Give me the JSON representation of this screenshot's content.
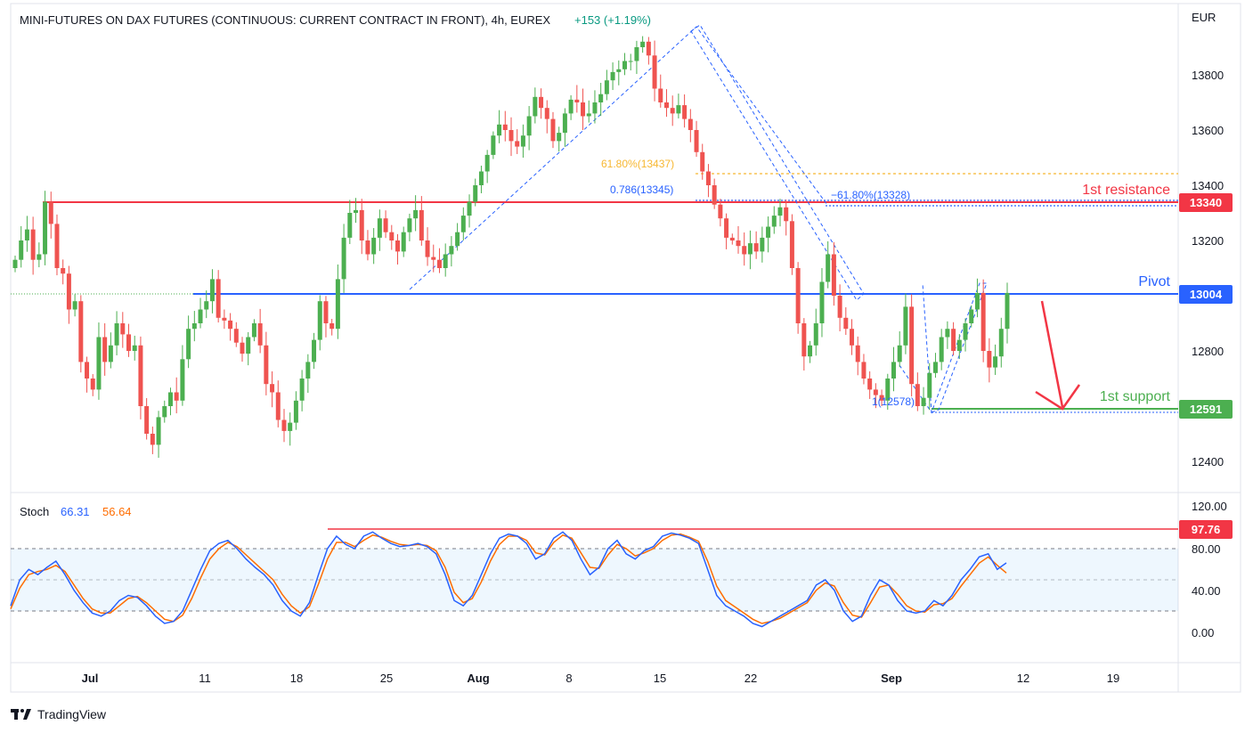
{
  "header": {
    "title": "MINI-FUTURES ON DAX FUTURES (CONTINUOUS: CURRENT CONTRACT IN FRONT), 4h, EUREX",
    "change": "+153 (+1.19%)",
    "currency": "EUR"
  },
  "annotations": {
    "fib_618_label": "61.80%(13437)",
    "fib_786_label": "0.786(13345)",
    "fib_neg618_label": "−61.80%(13328)",
    "fib_one_label": "1(12578)",
    "resistance_label": "1st resistance",
    "pivot_label": "Pivot",
    "support_label": "1st support"
  },
  "price_axis": {
    "ticks": [
      "13800",
      "13600",
      "13400",
      "13200",
      "12800",
      "12400"
    ],
    "badges": {
      "resistance": "13340",
      "pivot": "13004",
      "support": "12591"
    }
  },
  "stoch": {
    "label": "Stoch",
    "k_value": "66.31",
    "d_value": "56.64",
    "ticks": [
      "120.00",
      "80.00",
      "40.00",
      "0.00"
    ],
    "badge": "97.76"
  },
  "time_axis": {
    "labels": [
      "Jul",
      "11",
      "18",
      "25",
      "Aug",
      "8",
      "15",
      "22",
      "Sep",
      "12",
      "19"
    ]
  },
  "footer": {
    "brand": "TradingView"
  },
  "colors": {
    "up": "#26a69a",
    "up_body": "#4caf50",
    "down": "#ef5350",
    "resistance": "#f23645",
    "pivot": "#2962ff",
    "support": "#4caf50",
    "fib618": "#f7b731",
    "stoch_k": "#2962ff",
    "stoch_d": "#ff6d00"
  },
  "chart_data": [
    {
      "type": "candlestick",
      "title": "MINI-FUTURES ON DAX FUTURES (CONTINUOUS: CURRENT CONTRACT IN FRONT), 4h, EUREX",
      "ylabel": "EUR",
      "ylim": [
        12300,
        13900
      ],
      "x_ticks": [
        "Jul",
        "11",
        "18",
        "25",
        "Aug",
        "8",
        "15",
        "22",
        "Sep",
        "12",
        "19"
      ],
      "closes": [
        13130,
        13200,
        13240,
        13130,
        13150,
        13340,
        13260,
        13100,
        13080,
        12950,
        12980,
        12760,
        12700,
        12660,
        12850,
        12760,
        12820,
        12900,
        12860,
        12800,
        12820,
        12600,
        12500,
        12460,
        12560,
        12600,
        12650,
        12620,
        12770,
        12880,
        12900,
        12950,
        12980,
        13060,
        12920,
        12910,
        12880,
        12830,
        12790,
        12850,
        12900,
        12820,
        12680,
        12650,
        12550,
        12510,
        12540,
        12620,
        12700,
        12760,
        12840,
        12980,
        12900,
        12880,
        13060,
        13210,
        13300,
        13310,
        13200,
        13150,
        13210,
        13280,
        13230,
        13200,
        13160,
        13230,
        13280,
        13310,
        13200,
        13140,
        13130,
        13100,
        13150,
        13180,
        13230,
        13290,
        13340,
        13400,
        13450,
        13510,
        13580,
        13620,
        13600,
        13560,
        13540,
        13580,
        13650,
        13720,
        13680,
        13640,
        13560,
        13590,
        13660,
        13710,
        13700,
        13650,
        13660,
        13700,
        13730,
        13780,
        13810,
        13820,
        13850,
        13850,
        13900,
        13920,
        13870,
        13750,
        13700,
        13680,
        13660,
        13690,
        13640,
        13600,
        13520,
        13450,
        13400,
        13330,
        13280,
        13210,
        13200,
        13180,
        13150,
        13190,
        13160,
        13210,
        13250,
        13290,
        13320,
        13270,
        13100,
        12900,
        12780,
        12820,
        12900,
        13050,
        13150,
        13000,
        12920,
        12880,
        12820,
        12760,
        12700,
        12660,
        12640,
        12620,
        12700,
        12760,
        12820,
        12960,
        12680,
        12600,
        12630,
        12720,
        12760,
        12850,
        12880,
        12800,
        12840,
        12900,
        12950,
        13010,
        12800,
        12740,
        12780,
        12880,
        13010
      ],
      "levels": {
        "resistance": 13340,
        "pivot": 13004,
        "support": 12591,
        "fib_618": 13437,
        "fib_786": 13345,
        "fib_neg618": 13328,
        "fib_1": 12578
      },
      "last": 13004
    },
    {
      "type": "line",
      "title": "Stoch",
      "ylim": [
        -20,
        130
      ],
      "levels": [
        20,
        50,
        80,
        97.76
      ],
      "series": [
        {
          "name": "66.31",
          "values": [
            25,
            50,
            60,
            55,
            62,
            68,
            55,
            40,
            28,
            18,
            15,
            20,
            30,
            35,
            33,
            25,
            15,
            8,
            10,
            20,
            40,
            60,
            78,
            85,
            88,
            80,
            70,
            62,
            55,
            45,
            30,
            20,
            15,
            28,
            55,
            80,
            92,
            84,
            80,
            92,
            96,
            90,
            85,
            82,
            83,
            85,
            82,
            75,
            55,
            30,
            25,
            35,
            55,
            75,
            90,
            94,
            92,
            85,
            70,
            75,
            90,
            96,
            88,
            70,
            55,
            62,
            80,
            88,
            75,
            70,
            78,
            82,
            92,
            95,
            93,
            90,
            85,
            60,
            35,
            25,
            20,
            15,
            8,
            5,
            10,
            15,
            20,
            25,
            30,
            45,
            50,
            40,
            20,
            10,
            15,
            35,
            50,
            45,
            30,
            20,
            18,
            20,
            30,
            25,
            35,
            50,
            60,
            72,
            75,
            60,
            66.31
          ]
        },
        {
          "name": "56.64",
          "values": [
            22,
            42,
            55,
            58,
            60,
            64,
            58,
            45,
            32,
            22,
            18,
            18,
            25,
            32,
            34,
            28,
            20,
            12,
            10,
            16,
            32,
            52,
            70,
            80,
            86,
            82,
            74,
            66,
            58,
            50,
            36,
            25,
            18,
            24,
            46,
            70,
            86,
            86,
            82,
            88,
            93,
            91,
            87,
            84,
            83,
            84,
            83,
            78,
            62,
            38,
            28,
            32,
            48,
            68,
            84,
            92,
            92,
            88,
            76,
            74,
            86,
            93,
            90,
            76,
            62,
            61,
            74,
            84,
            80,
            73,
            76,
            80,
            88,
            93,
            94,
            91,
            87,
            68,
            44,
            30,
            24,
            18,
            12,
            8,
            10,
            13,
            18,
            23,
            28,
            40,
            47,
            44,
            28,
            16,
            14,
            28,
            43,
            45,
            36,
            25,
            20,
            19,
            26,
            27,
            32,
            44,
            55,
            66,
            72,
            64,
            56.64
          ]
        }
      ]
    }
  ]
}
